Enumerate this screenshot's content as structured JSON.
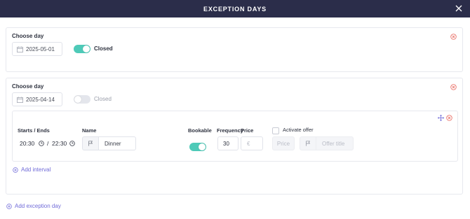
{
  "header": {
    "title": "EXCEPTION DAYS"
  },
  "days": [
    {
      "choose_label": "Choose day",
      "date": "2025-05-01",
      "closed_label": "Closed",
      "closed": true
    },
    {
      "choose_label": "Choose day",
      "date": "2025-04-14",
      "closed_label": "Closed",
      "closed": false,
      "interval": {
        "starts_ends_label": "Starts / Ends",
        "start_time": "20:30",
        "separator": "/",
        "end_time": "22:30",
        "name_label": "Name",
        "name_value": "Dinner",
        "bookable_label": "Bookable",
        "bookable": true,
        "frequency_label": "Frequency",
        "frequency_value": "30",
        "price_label": "Price",
        "currency_symbol": "€",
        "activate_offer_label": "Activate offer",
        "offer_price_placeholder": "Price",
        "offer_title_placeholder": "Offer title"
      },
      "add_interval_label": "Add interval"
    }
  ],
  "add_exception_day_label": "Add exception day",
  "colors": {
    "header_bg": "#2b2d4a",
    "toggle_on": "#4ecab8",
    "remove_red": "#e8645a",
    "link_purple": "#6f6ad8"
  },
  "icons": [
    "close-icon",
    "calendar-icon",
    "remove-circle-icon",
    "move-icon",
    "clock-icon",
    "flag-icon",
    "plus-circle-icon"
  ]
}
